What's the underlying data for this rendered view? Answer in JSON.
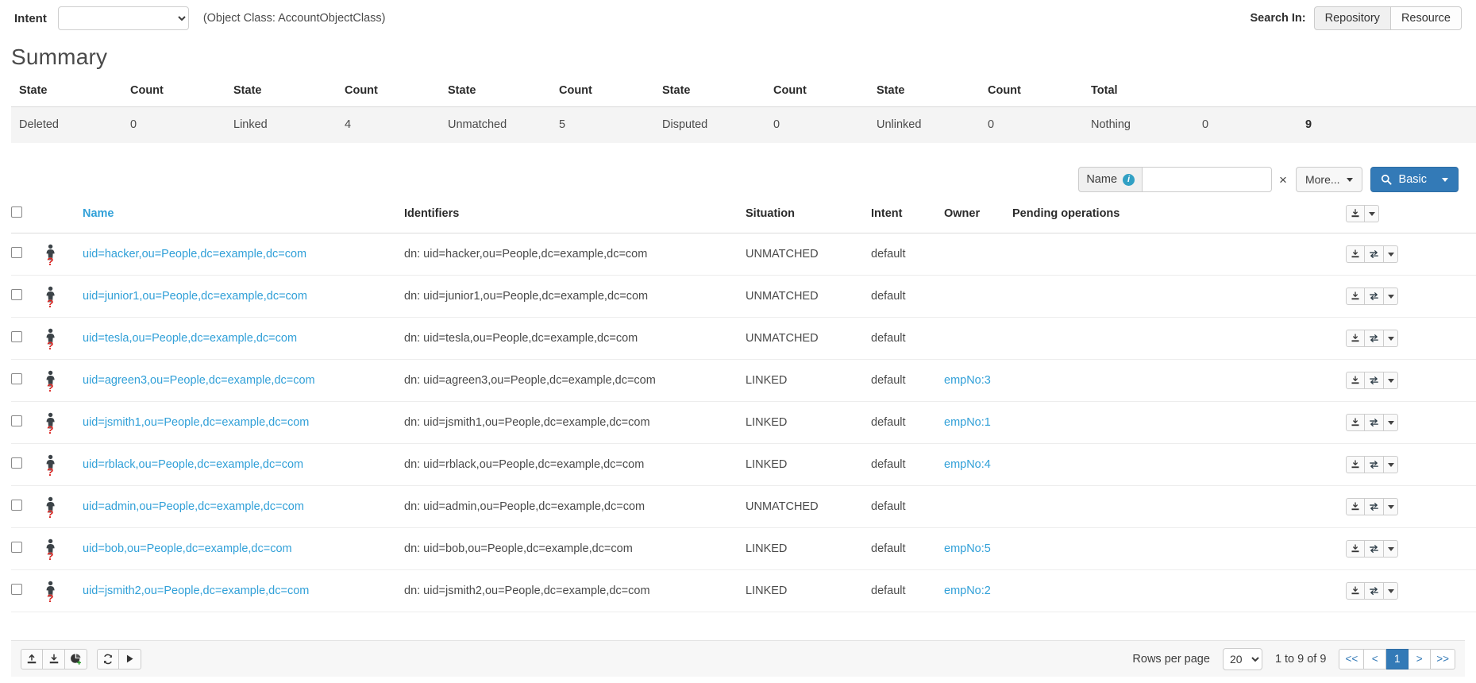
{
  "topbar": {
    "intent_label": "Intent",
    "intent_value": "",
    "object_class_note": "(Object Class: AccountObjectClass)",
    "search_in_label": "Search In:",
    "repository_btn": "Repository",
    "resource_btn": "Resource"
  },
  "summary": {
    "title": "Summary",
    "headers": [
      "State",
      "Count",
      "State",
      "Count",
      "State",
      "Count",
      "State",
      "Count",
      "State",
      "Count",
      "Total"
    ],
    "row": [
      "Deleted",
      "0",
      "Linked",
      "4",
      "Unmatched",
      "5",
      "Disputed",
      "0",
      "Unlinked",
      "0",
      "Nothing",
      "0",
      "9"
    ]
  },
  "filter": {
    "name_label": "Name",
    "info_icon": "info-icon",
    "name_value": "",
    "clear_label": "×",
    "more_label": "More...",
    "search_label": "Basic",
    "search_icon": "search-icon"
  },
  "table": {
    "headers": {
      "select": "",
      "name": "Name",
      "identifiers": "Identifiers",
      "situation": "Situation",
      "intent": "Intent",
      "owner": "Owner",
      "pending": "Pending operations"
    },
    "rows": [
      {
        "name": "uid=hacker,ou=People,dc=example,dc=com",
        "identifier": "dn: uid=hacker,ou=People,dc=example,dc=com",
        "situation": "UNMATCHED",
        "intent": "default",
        "owner": "",
        "pending": ""
      },
      {
        "name": "uid=junior1,ou=People,dc=example,dc=com",
        "identifier": "dn: uid=junior1,ou=People,dc=example,dc=com",
        "situation": "UNMATCHED",
        "intent": "default",
        "owner": "",
        "pending": ""
      },
      {
        "name": "uid=tesla,ou=People,dc=example,dc=com",
        "identifier": "dn: uid=tesla,ou=People,dc=example,dc=com",
        "situation": "UNMATCHED",
        "intent": "default",
        "owner": "",
        "pending": ""
      },
      {
        "name": "uid=agreen3,ou=People,dc=example,dc=com",
        "identifier": "dn: uid=agreen3,ou=People,dc=example,dc=com",
        "situation": "LINKED",
        "intent": "default",
        "owner": "empNo:3",
        "pending": ""
      },
      {
        "name": "uid=jsmith1,ou=People,dc=example,dc=com",
        "identifier": "dn: uid=jsmith1,ou=People,dc=example,dc=com",
        "situation": "LINKED",
        "intent": "default",
        "owner": "empNo:1",
        "pending": ""
      },
      {
        "name": "uid=rblack,ou=People,dc=example,dc=com",
        "identifier": "dn: uid=rblack,ou=People,dc=example,dc=com",
        "situation": "LINKED",
        "intent": "default",
        "owner": "empNo:4",
        "pending": ""
      },
      {
        "name": "uid=admin,ou=People,dc=example,dc=com",
        "identifier": "dn: uid=admin,ou=People,dc=example,dc=com",
        "situation": "UNMATCHED",
        "intent": "default",
        "owner": "",
        "pending": ""
      },
      {
        "name": "uid=bob,ou=People,dc=example,dc=com",
        "identifier": "dn: uid=bob,ou=People,dc=example,dc=com",
        "situation": "LINKED",
        "intent": "default",
        "owner": "empNo:5",
        "pending": ""
      },
      {
        "name": "uid=jsmith2,ou=People,dc=example,dc=com",
        "identifier": "dn: uid=jsmith2,ou=People,dc=example,dc=com",
        "situation": "LINKED",
        "intent": "default",
        "owner": "empNo:2",
        "pending": ""
      }
    ]
  },
  "footer": {
    "buttons": [
      "export-icon",
      "import-icon",
      "pie-chart-plus-icon",
      "refresh-icon",
      "play-icon"
    ],
    "rows_per_page_label": "Rows per page",
    "rows_per_page_value": "20",
    "range_text": "1 to 9 of 9",
    "pages": [
      "<<",
      "<",
      "1",
      ">",
      ">>"
    ],
    "active_page": "1"
  },
  "colors": {
    "link": "#31a0d8",
    "primary": "#337ab7",
    "summary_row_bg": "#f4f4f4",
    "badge_red": "#d9231f"
  }
}
